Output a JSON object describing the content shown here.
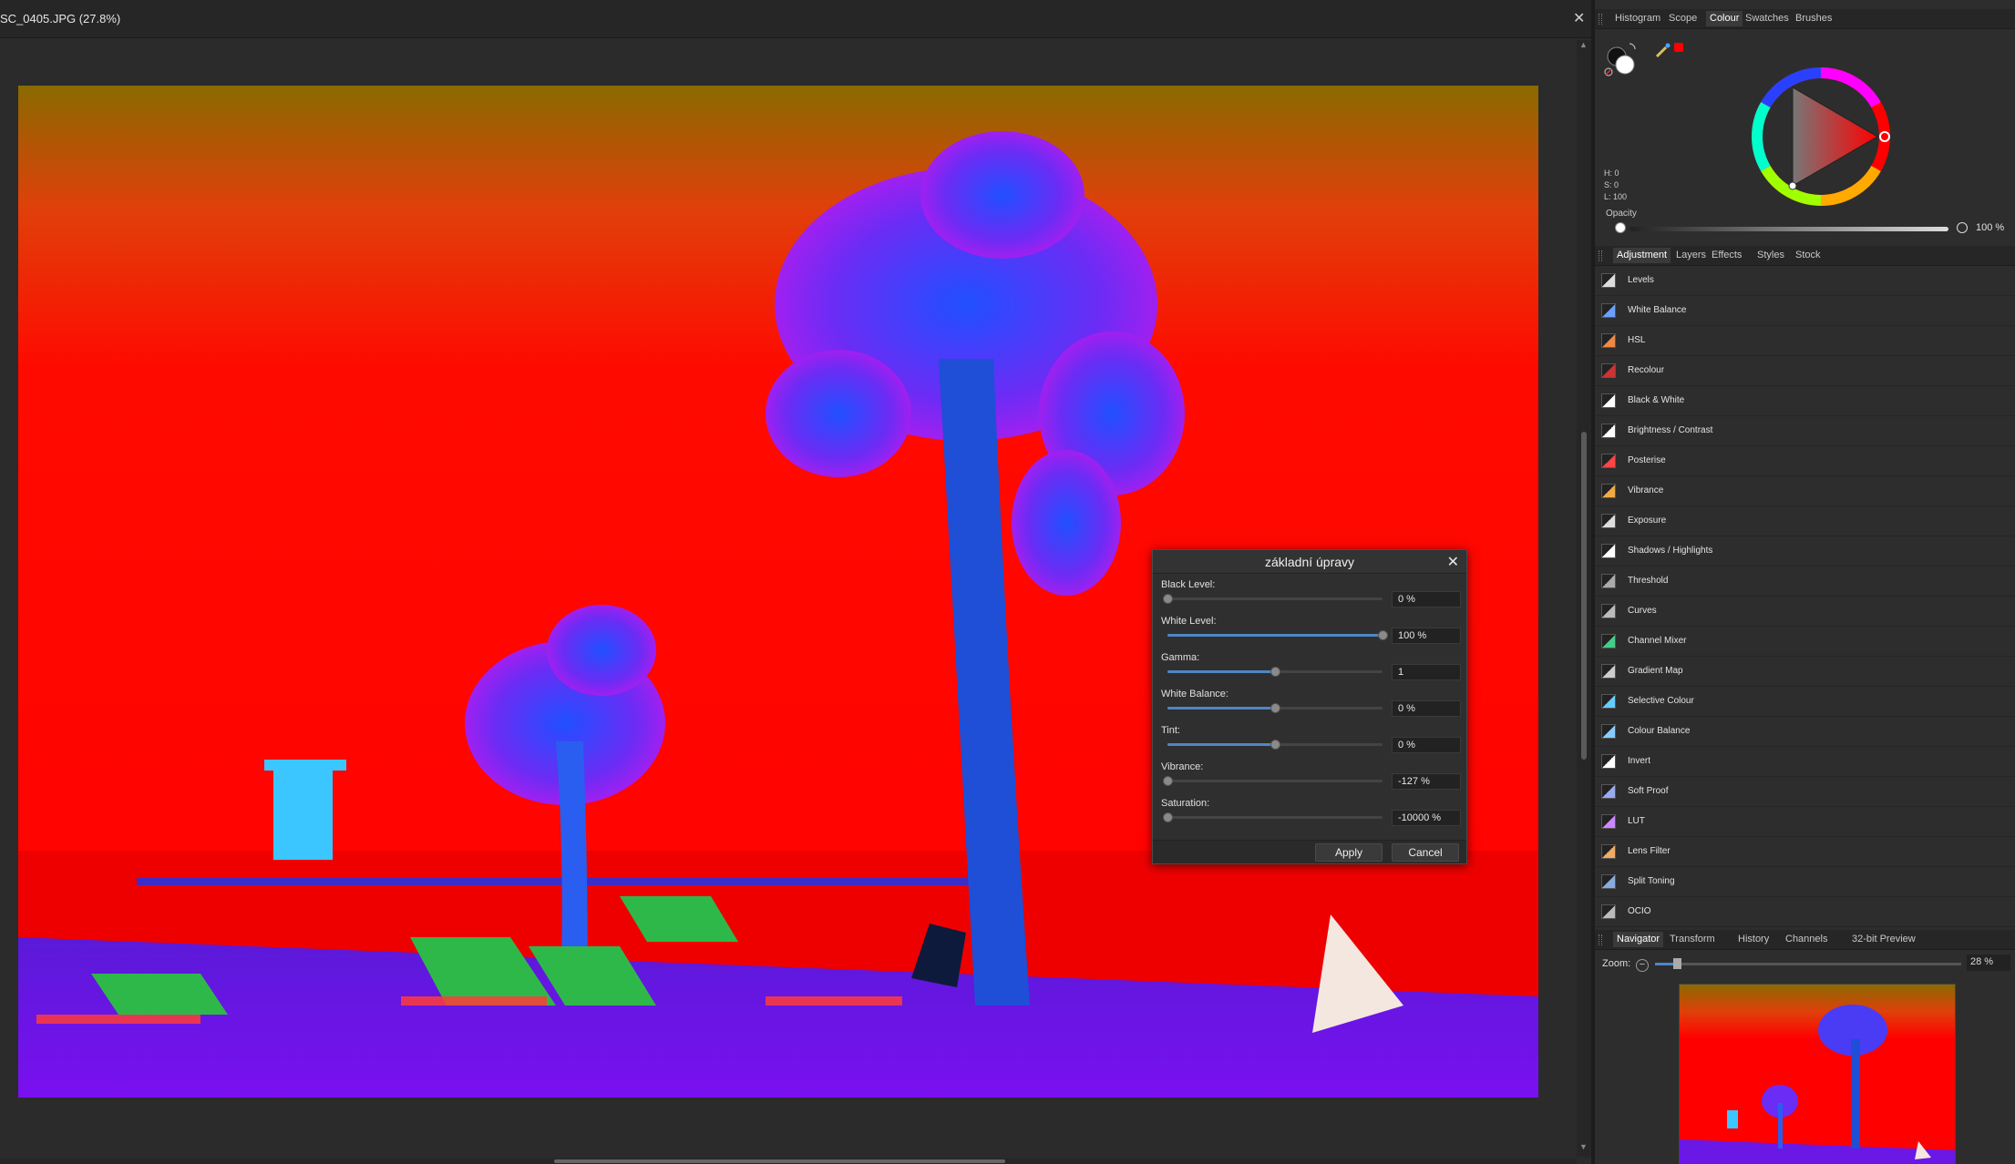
{
  "document": {
    "title": "SC_0405.JPG (27.8%)",
    "close_glyph": "✕"
  },
  "dialog": {
    "title": "základní úpravy",
    "close_glyph": "✕",
    "rows": [
      {
        "label": "Black Level:",
        "value": "0 %",
        "level": 0.0,
        "filled": false
      },
      {
        "label": "White Level:",
        "value": "100 %",
        "level": 1.0,
        "filled": true
      },
      {
        "label": "Gamma:",
        "value": "1",
        "level": 0.5,
        "filled": true
      },
      {
        "label": "White Balance:",
        "value": "0 %",
        "level": 0.5,
        "filled": true
      },
      {
        "label": "Tint:",
        "value": "0 %",
        "level": 0.5,
        "filled": true
      },
      {
        "label": "Vibrance:",
        "value": "-127 %",
        "level": 0.0,
        "filled": false
      },
      {
        "label": "Saturation:",
        "value": "-10000 %",
        "level": 0.0,
        "filled": false
      }
    ],
    "apply_label": "Apply",
    "cancel_label": "Cancel"
  },
  "top_tabs": {
    "items": [
      "Histogram",
      "Scope",
      "Colour",
      "Swatches",
      "Brushes"
    ],
    "active": "Colour"
  },
  "colour": {
    "h": "H: 0",
    "s": "S: 0",
    "l": "L: 100",
    "opacity_label": "Opacity",
    "opacity_value": "100 %",
    "picked_color": "#ff0000"
  },
  "mid_tabs": {
    "items": [
      "Adjustment",
      "Layers",
      "Effects",
      "Styles",
      "Stock"
    ],
    "active": "Adjustment"
  },
  "adjustments": [
    {
      "name": "Levels",
      "icon": "levels-icon"
    },
    {
      "name": "White Balance",
      "icon": "white-balance-icon"
    },
    {
      "name": "HSL",
      "icon": "hsl-icon"
    },
    {
      "name": "Recolour",
      "icon": "recolour-icon"
    },
    {
      "name": "Black & White",
      "icon": "black-white-icon"
    },
    {
      "name": "Brightness / Contrast",
      "icon": "brightness-contrast-icon"
    },
    {
      "name": "Posterise",
      "icon": "posterise-icon"
    },
    {
      "name": "Vibrance",
      "icon": "vibrance-icon"
    },
    {
      "name": "Exposure",
      "icon": "exposure-icon"
    },
    {
      "name": "Shadows / Highlights",
      "icon": "shadows-highlights-icon"
    },
    {
      "name": "Threshold",
      "icon": "threshold-icon"
    },
    {
      "name": "Curves",
      "icon": "curves-icon"
    },
    {
      "name": "Channel Mixer",
      "icon": "channel-mixer-icon"
    },
    {
      "name": "Gradient Map",
      "icon": "gradient-map-icon"
    },
    {
      "name": "Selective Colour",
      "icon": "selective-colour-icon"
    },
    {
      "name": "Colour Balance",
      "icon": "colour-balance-icon"
    },
    {
      "name": "Invert",
      "icon": "invert-icon"
    },
    {
      "name": "Soft Proof",
      "icon": "soft-proof-icon"
    },
    {
      "name": "LUT",
      "icon": "lut-icon"
    },
    {
      "name": "Lens Filter",
      "icon": "lens-filter-icon"
    },
    {
      "name": "Split Toning",
      "icon": "split-toning-icon"
    },
    {
      "name": "OCIO",
      "icon": "ocio-icon"
    }
  ],
  "bottom_tabs": {
    "items": [
      "Navigator",
      "Transform",
      "History",
      "Channels",
      "32-bit Preview"
    ],
    "active": "Navigator"
  },
  "navigator": {
    "zoom_label": "Zoom:",
    "zoom_value": "28 %",
    "zoom_level": 0.07
  }
}
